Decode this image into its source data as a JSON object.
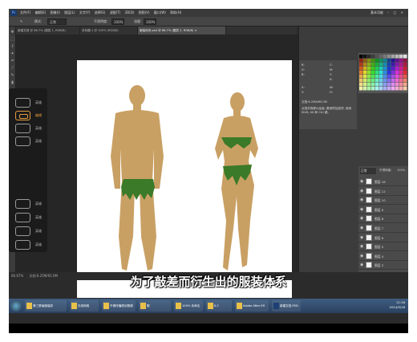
{
  "menubar": {
    "logo": "Ps",
    "menus": [
      "文件(F)",
      "编辑(E)",
      "图像(I)",
      "图层(L)",
      "文字(Y)",
      "选择(S)",
      "滤镜(T)",
      "3D(D)",
      "视图(V)",
      "窗口(W)",
      "帮助(H)"
    ],
    "workspace": "基本功能"
  },
  "options": {
    "mode_label": "不透明度:",
    "opacity": "100%",
    "flow_label": "流量:",
    "flow": "100%",
    "blend_label": "模式:",
    "blend": "正常"
  },
  "tabs": [
    {
      "label": "新建文档 @ 66.7% (图层 1, RGB/8)",
      "active": false
    },
    {
      "label": "未标题-1 @ 100% (RGB/8)",
      "active": false
    },
    {
      "label": "服装体系.psd @ 66.7% (图层 2, RGB/8) ×",
      "active": true
    }
  ],
  "status": {
    "zoom": "66.67%",
    "doc": "文档:6.25M/65.0M"
  },
  "left_panel": {
    "items": [
      {
        "label": "英雄",
        "selected": false
      },
      {
        "label": "编辑",
        "selected": true
      },
      {
        "label": "英雄",
        "selected": false
      },
      {
        "label": "英雄",
        "selected": false
      },
      {
        "label": "英雄",
        "selected": false
      },
      {
        "label": "英雄",
        "selected": false
      },
      {
        "label": "英雄",
        "selected": false
      },
      {
        "label": "英雄",
        "selected": false
      }
    ]
  },
  "info_panel": {
    "r": "R:",
    "g": "G:",
    "b": "B:",
    "c": "C:",
    "m": "M:",
    "y": "Y:",
    "k": "K:",
    "x": "X:",
    "y2": "Y:",
    "w": "W:",
    "h": "H:",
    "doc": "文档:6.25M/65.0M",
    "hint": "点按并拖移以绘画, 要用附加选项, 使用 Shift, Alt 和 Ctrl 键。"
  },
  "layers_panel": {
    "blend": "正常",
    "opacity_label": "不透明度:",
    "opacity": "100%",
    "rows": [
      {
        "label": "图层 18"
      },
      {
        "label": "图层 12"
      },
      {
        "label": "图层 10"
      },
      {
        "label": "图层 9"
      },
      {
        "label": "图层 8"
      },
      {
        "label": "图层 7"
      },
      {
        "label": "图层 6"
      },
      {
        "label": "图层 5"
      },
      {
        "label": "图层 4"
      },
      {
        "label": "图层 3"
      }
    ]
  },
  "subtitle": "为了敲差而衍生出的服装体系",
  "taskbar": {
    "items": [
      {
        "label": "第三屏画服装初",
        "ps": false
      },
      {
        "label": "无线网络",
        "ps": false
      },
      {
        "label": "不便传播原创视频",
        "ps": false
      },
      {
        "label": "服",
        "ps": false
      },
      {
        "label": "100% 未命名",
        "ps": false
      },
      {
        "label": "6.2",
        "ps": false
      },
      {
        "label": "Adobe After Eff",
        "ps": false
      },
      {
        "label": "新建文档.PSD",
        "ps": true
      }
    ],
    "time": "11:16",
    "date": "2014/5/18"
  },
  "colors": {
    "skin": "#c9a064",
    "leaf": "#3a7a28",
    "accent": "#e39a3e"
  }
}
